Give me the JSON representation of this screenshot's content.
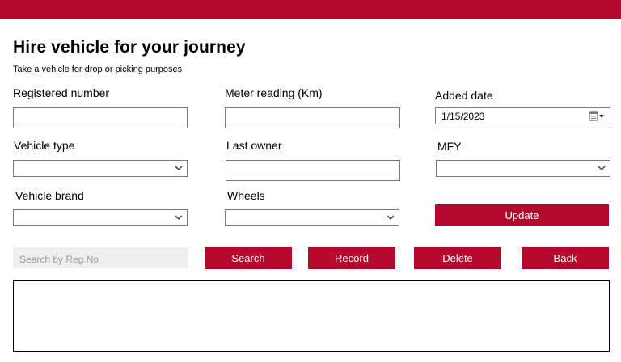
{
  "header": {
    "title": "Hire vehicle for your journey",
    "subtitle": "Take a vehicle for drop or picking purposes"
  },
  "form": {
    "registered_number": {
      "label": "Registered number",
      "value": ""
    },
    "meter_reading": {
      "label": "Meter reading (Km)",
      "value": ""
    },
    "added_date": {
      "label": "Added date",
      "value": "1/15/2023"
    },
    "vehicle_type": {
      "label": "Vehicle type",
      "value": ""
    },
    "last_owner": {
      "label": "Last owner",
      "value": ""
    },
    "mfy": {
      "label": "MFY",
      "value": ""
    },
    "vehicle_brand": {
      "label": "Vehicle brand",
      "value": ""
    },
    "wheels": {
      "label": "Wheels",
      "value": ""
    }
  },
  "buttons": {
    "update": "Update",
    "search": "Search",
    "record": "Record",
    "delete": "Delete",
    "back": "Back"
  },
  "search": {
    "placeholder": "Search by Reg.No"
  },
  "colors": {
    "accent": "#b5092e",
    "field_border": "#7a7a7a",
    "search_bg": "#efefef"
  },
  "icons": {
    "dropdown": "chevron-down-icon",
    "calendar": "calendar-icon"
  }
}
